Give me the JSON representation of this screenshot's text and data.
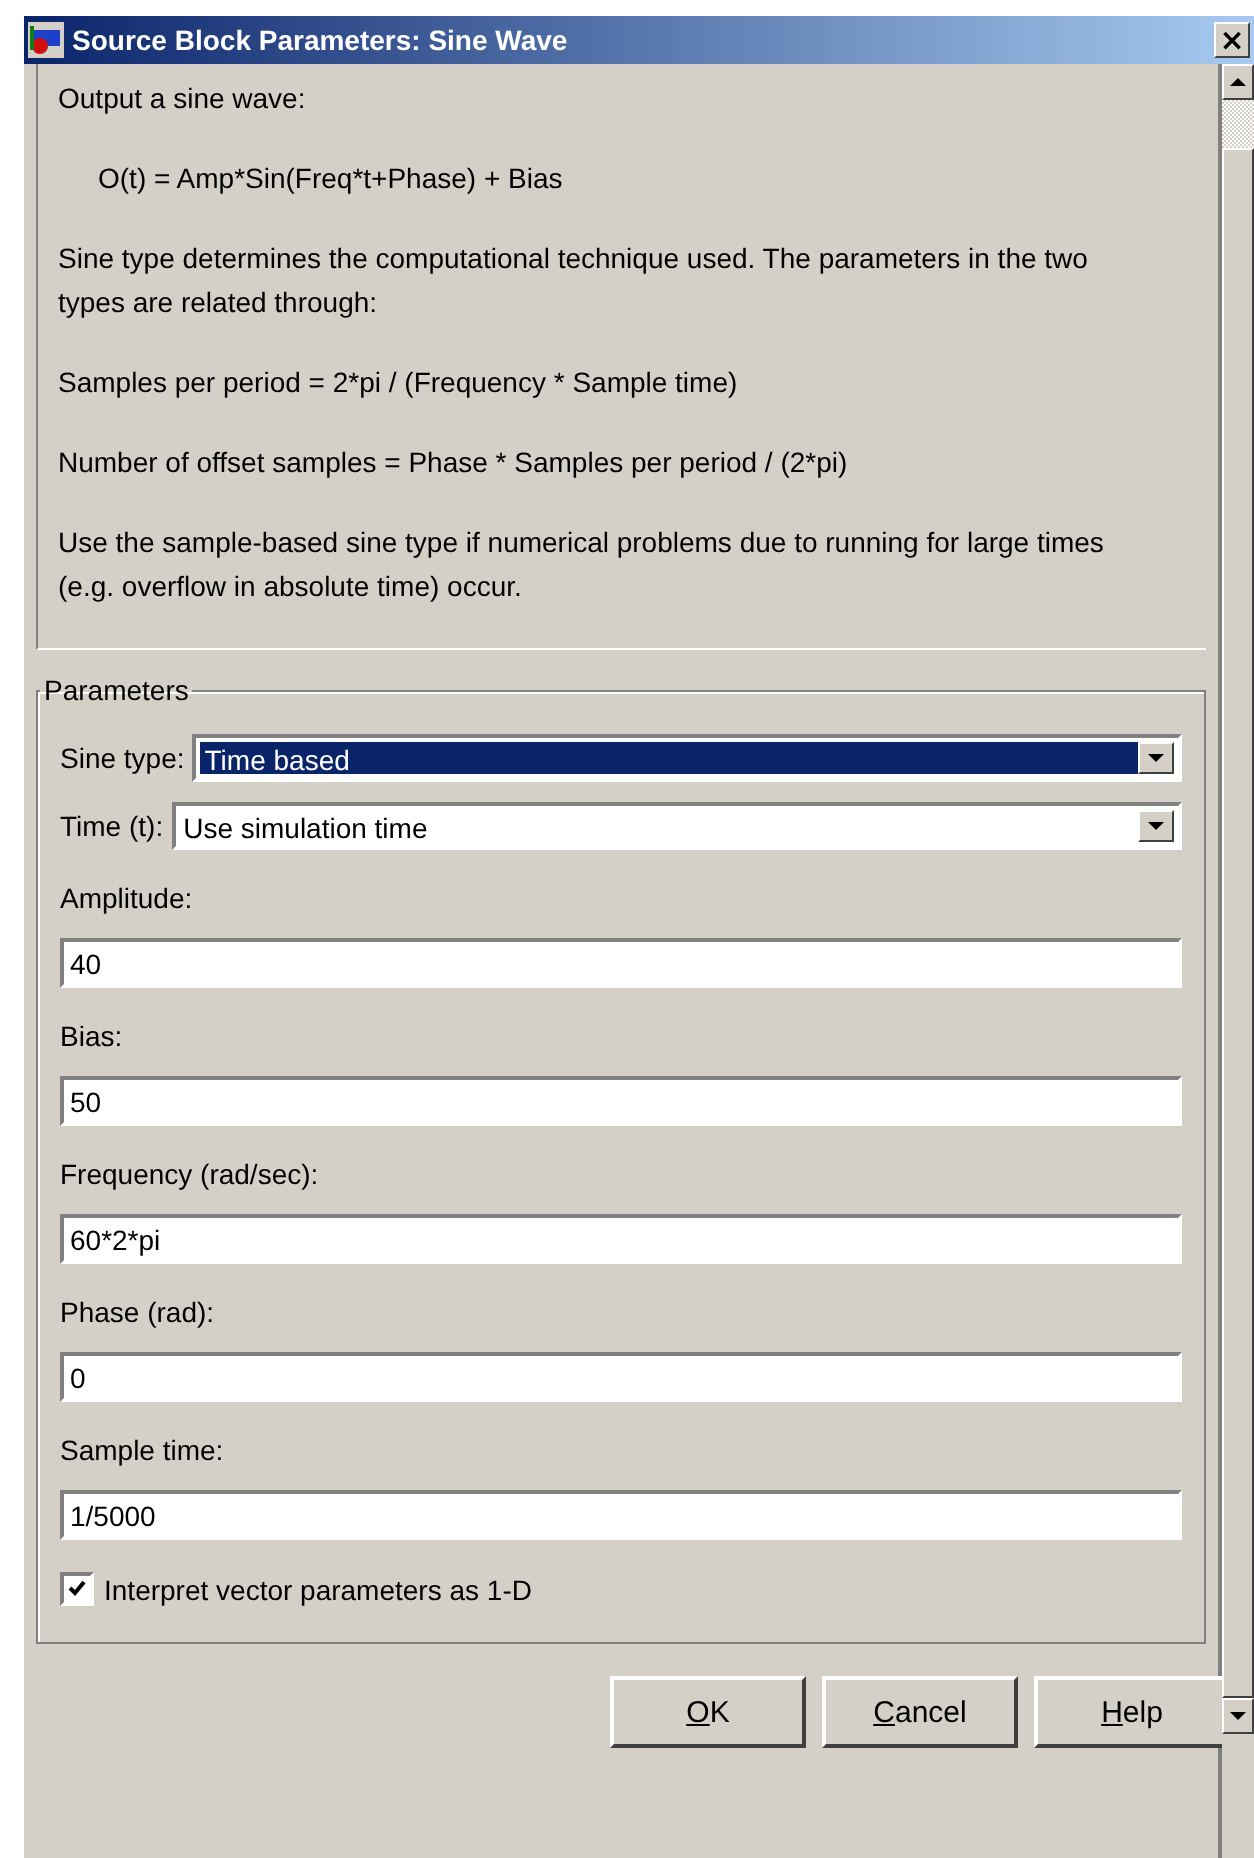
{
  "window": {
    "title": "Source Block Parameters: Sine Wave",
    "close": "×"
  },
  "description": [
    "Output a sine wave:",
    "O(t) = Amp*Sin(Freq*t+Phase) + Bias",
    "Sine type determines the computational technique used. The parameters in the two types are related through:",
    "Samples per period = 2*pi / (Frequency * Sample time)",
    "Number of offset samples = Phase * Samples per period / (2*pi)",
    "Use the sample-based sine type if numerical problems due to running for large times (e.g. overflow in absolute time) occur."
  ],
  "parameters": {
    "title": "Parameters",
    "dropdowns": [
      {
        "label": "Sine type:",
        "value": "Time based",
        "focused": true
      },
      {
        "label": "Time (t):",
        "value": "Use simulation time",
        "focused": false
      }
    ],
    "fields": [
      {
        "label": "Amplitude:",
        "value": "40"
      },
      {
        "label": "Bias:",
        "value": "50"
      },
      {
        "label": "Frequency (rad/sec):",
        "value": "60*2*pi"
      },
      {
        "label": "Phase (rad):",
        "value": "0"
      },
      {
        "label": "Sample time:",
        "value": "1/5000"
      }
    ],
    "checkbox": {
      "label": "Interpret vector parameters as 1-D",
      "checked": true
    }
  },
  "buttons": [
    {
      "label": "OK"
    },
    {
      "label": "Cancel"
    },
    {
      "label": "Help"
    }
  ]
}
